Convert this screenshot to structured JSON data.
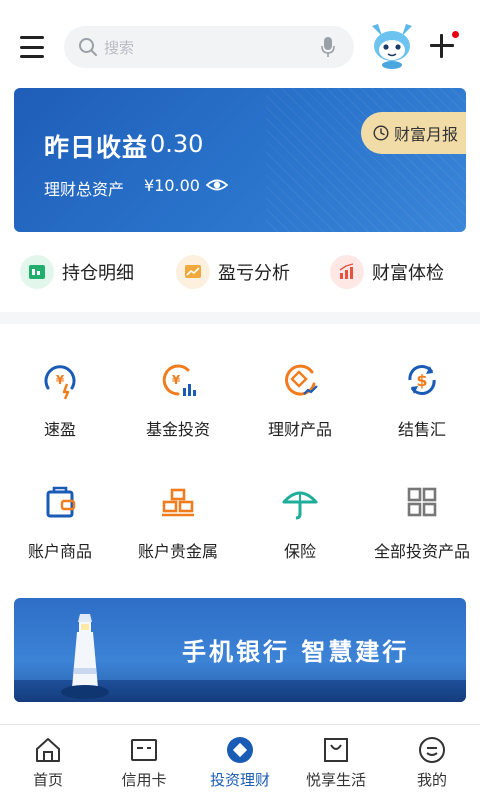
{
  "header": {
    "search_placeholder": "搜索",
    "menu_icon": "menu-icon",
    "add_icon": "plus-icon",
    "mascot": "mascot-avatar"
  },
  "assets": {
    "yield_label": "昨日收益",
    "yield_value": "0.30",
    "total_label": "理财总资产",
    "total_value": "¥10.00",
    "report_button": "财富月报"
  },
  "quick_links": [
    {
      "label": "持仓明细",
      "icon": "holdings-icon"
    },
    {
      "label": "盈亏分析",
      "icon": "chart-icon"
    },
    {
      "label": "财富体检",
      "icon": "bar-chart-icon"
    }
  ],
  "grid": [
    {
      "label": "速盈",
      "icon": "quick-profit-icon"
    },
    {
      "label": "基金投资",
      "icon": "fund-icon"
    },
    {
      "label": "理财产品",
      "icon": "wealth-product-icon"
    },
    {
      "label": "结售汇",
      "icon": "exchange-icon"
    },
    {
      "label": "账户商品",
      "icon": "bag-icon"
    },
    {
      "label": "账户贵金属",
      "icon": "gold-bars-icon"
    },
    {
      "label": "保险",
      "icon": "umbrella-icon"
    },
    {
      "label": "全部投资产品",
      "icon": "grid-icon"
    }
  ],
  "banner": {
    "slogan": "手机银行  智慧建行"
  },
  "bottom_nav": [
    {
      "label": "首页",
      "icon": "home-icon"
    },
    {
      "label": "信用卡",
      "icon": "credit-card-icon"
    },
    {
      "label": "投资理财",
      "icon": "invest-icon",
      "active": true
    },
    {
      "label": "悦享生活",
      "icon": "lifestyle-icon"
    },
    {
      "label": "我的",
      "icon": "profile-icon"
    }
  ],
  "colors": {
    "primary": "#1a5bb5",
    "card_blue": "#2a74cc",
    "report_gold": "#f1dba7",
    "orange": "#f07c1e",
    "green": "#1fae6b",
    "red_dot": "#e60012"
  }
}
